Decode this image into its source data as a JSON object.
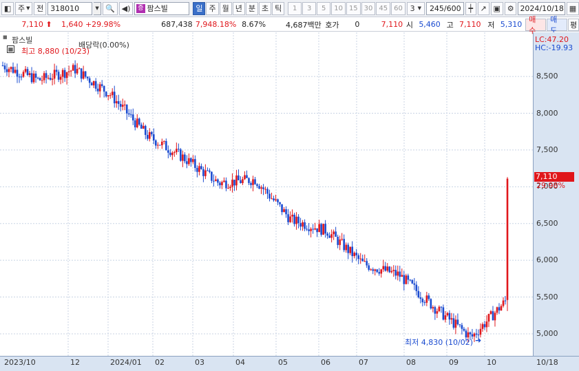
{
  "toolbar": {
    "market": "주",
    "prev": "전",
    "code": "318010",
    "name_tag": "증",
    "name": "팜스빌",
    "periods": [
      "일",
      "주",
      "월",
      "년",
      "분",
      "초",
      "틱"
    ],
    "period_selected": "일",
    "nums": [
      "1",
      "3",
      "5",
      "10",
      "15",
      "30",
      "45",
      "60"
    ],
    "interval": "3",
    "count": "245/600",
    "date": "2024/10/18"
  },
  "quote": {
    "price": "7,110",
    "change": "1,640",
    "change_pct": "+29.98%",
    "volume": "687,438",
    "volume_pct": "7,948.18%",
    "turnover": "8.67%",
    "amount": "4,687백만",
    "hoga_label": "호가",
    "hoga_value": "0",
    "hoga_price": "7,110",
    "open_label": "시",
    "open": "5,460",
    "high_label": "고",
    "high": "7,110",
    "low_label": "저",
    "low": "5,310",
    "buy": "매수",
    "sell": "매도",
    "eval": "평"
  },
  "chart_data": {
    "type": "candlestick",
    "legend": "팜스빌",
    "annotations": {
      "high": "최고 8,880 (10/23)",
      "low": "최저 4,830 (10/02)",
      "dividend": "배당락(0.00%)",
      "lc": "LC:47.20",
      "hc": "HC:-19.93",
      "last_price": "7,110",
      "last_pct": "29.98%"
    },
    "ylim": [
      4700,
      9100
    ],
    "y_ticks": [
      "8,500",
      "8,000",
      "7,500",
      "7,000",
      "6,500",
      "6,000",
      "5,500",
      "5,000"
    ],
    "x_labels": [
      "2023/10",
      "12",
      "2024/01",
      "02",
      "03",
      "04",
      "05",
      "06",
      "07",
      "08",
      "09",
      "10",
      "10/18"
    ],
    "approx_close_path": [
      [
        "2023/10",
        8650
      ],
      [
        "2023/11",
        8450
      ],
      [
        "2023/12",
        8600
      ],
      [
        "2024/01",
        8250
      ],
      [
        "2024/01b",
        7700
      ],
      [
        "2024/02",
        7400
      ],
      [
        "2024/03",
        7050
      ],
      [
        "2024/04",
        7100
      ],
      [
        "2024/05",
        6550
      ],
      [
        "2024/06",
        6400
      ],
      [
        "2024/07",
        5950
      ],
      [
        "2024/08",
        5800
      ],
      [
        "2024/09",
        5350
      ],
      [
        "2024/10",
        4950
      ],
      [
        "2024/10/17",
        5470
      ],
      [
        "2024/10/18",
        7110
      ]
    ]
  }
}
